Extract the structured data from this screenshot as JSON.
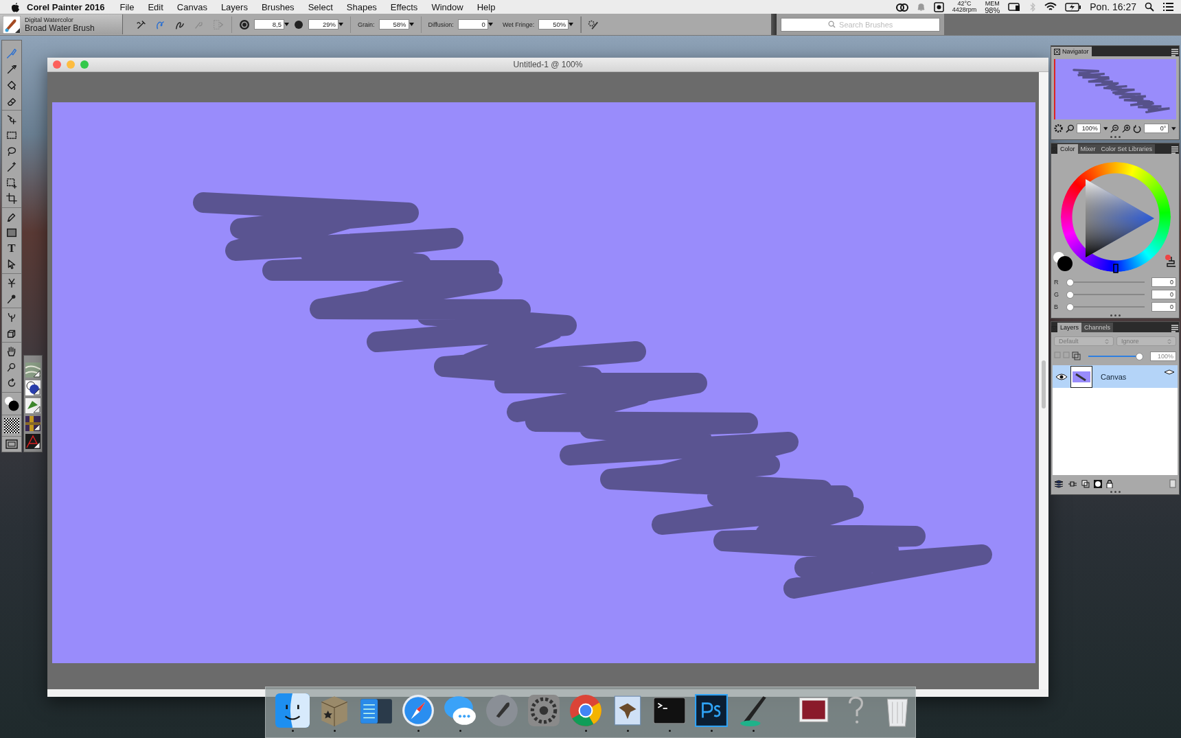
{
  "menu_bar": {
    "app_name": "Corel Painter 2016",
    "menus": [
      "File",
      "Edit",
      "Canvas",
      "Layers",
      "Brushes",
      "Select",
      "Shapes",
      "Effects",
      "Window",
      "Help"
    ],
    "status": {
      "temperature": "42°C",
      "fan_speed": "4428rpm",
      "memory_label": "MEM",
      "memory": "98%",
      "clock": "Pon. 16:27"
    }
  },
  "brush_selector": {
    "category": "Digital Watercolor",
    "variant": "Broad Water Brush"
  },
  "property_bar": {
    "stroke_types": [
      {
        "selected": true
      },
      {
        "selected": false
      }
    ],
    "size": "8,5",
    "opacity": "29%",
    "grain_label": "Grain:",
    "grain": "58%",
    "diffusion_label": "Diffusion:",
    "diffusion": "0",
    "wet_fringe_label": "Wet Fringe:",
    "wet_fringe": "50%"
  },
  "search": {
    "placeholder": "Search Brushes"
  },
  "toolbox": {
    "groups": [
      {
        "tools": [
          {
            "kind": "brush",
            "selected": true
          },
          {
            "kind": "dropper",
            "selected": false
          },
          {
            "kind": "bucket",
            "selected": false
          },
          {
            "kind": "eraser",
            "selected": false
          }
        ]
      },
      {
        "tools": [
          {
            "kind": "move",
            "selected": false
          },
          {
            "kind": "rect-select",
            "selected": false
          },
          {
            "kind": "lasso",
            "selected": false
          },
          {
            "kind": "wand",
            "selected": false
          },
          {
            "kind": "transform",
            "selected": false
          },
          {
            "kind": "crop",
            "selected": false
          }
        ]
      },
      {
        "tools": [
          {
            "kind": "pen",
            "selected": false
          },
          {
            "kind": "rect",
            "selected": false
          },
          {
            "kind": "text",
            "glyph": "T",
            "selected": false
          },
          {
            "kind": "pointer",
            "selected": false
          }
        ]
      },
      {
        "tools": [
          {
            "kind": "cloner",
            "selected": false
          },
          {
            "kind": "stamp",
            "selected": false
          }
        ]
      },
      {
        "tools": [
          {
            "kind": "dodge",
            "selected": false
          },
          {
            "kind": "cube",
            "selected": false
          }
        ]
      },
      {
        "tools": [
          {
            "kind": "hand",
            "selected": false
          },
          {
            "kind": "magnifier",
            "selected": false
          },
          {
            "kind": "rotate",
            "selected": false
          }
        ]
      }
    ]
  },
  "document": {
    "title": "Untitled-1 @ 100%"
  },
  "navigator": {
    "tab": "Navigator",
    "zoom": "100%",
    "rotation": "0°"
  },
  "color_panel": {
    "tabs": [
      {
        "label": "Color",
        "selected": true
      },
      {
        "label": "Mixer",
        "selected": false
      },
      {
        "label": "Color Set Libraries",
        "selected": false
      }
    ],
    "channels": [
      {
        "name": "R",
        "value": "0",
        "level": 0
      },
      {
        "name": "G",
        "value": "0",
        "level": 0
      },
      {
        "name": "B",
        "value": "0",
        "level": 0
      }
    ]
  },
  "layers_panel": {
    "tabs": [
      {
        "label": "Layers",
        "selected": true
      },
      {
        "label": "Channels",
        "selected": false
      }
    ],
    "composite_method": "Default",
    "composite_depth": "Ignore",
    "opacity": "100%",
    "opacity_slider": {
      "level": 1
    },
    "layers": [
      {
        "name": "Canvas",
        "selected": true,
        "visible": true
      }
    ]
  },
  "dock": {
    "apps": [
      {
        "kind": "finder",
        "running": true
      },
      {
        "kind": "package",
        "running": true
      },
      {
        "kind": "files",
        "running": false
      },
      {
        "kind": "safari",
        "running": true
      },
      {
        "kind": "messages",
        "running": true
      },
      {
        "kind": "launchpad",
        "running": false
      },
      {
        "kind": "settings",
        "running": false
      },
      {
        "kind": "chrome",
        "running": true
      },
      {
        "kind": "mail",
        "running": true
      },
      {
        "kind": "terminal",
        "running": true
      },
      {
        "kind": "photoshop",
        "running": true
      },
      {
        "kind": "painter",
        "running": true
      }
    ],
    "others": [
      {
        "kind": "photo"
      },
      {
        "kind": "help"
      },
      {
        "kind": "trash"
      }
    ]
  }
}
